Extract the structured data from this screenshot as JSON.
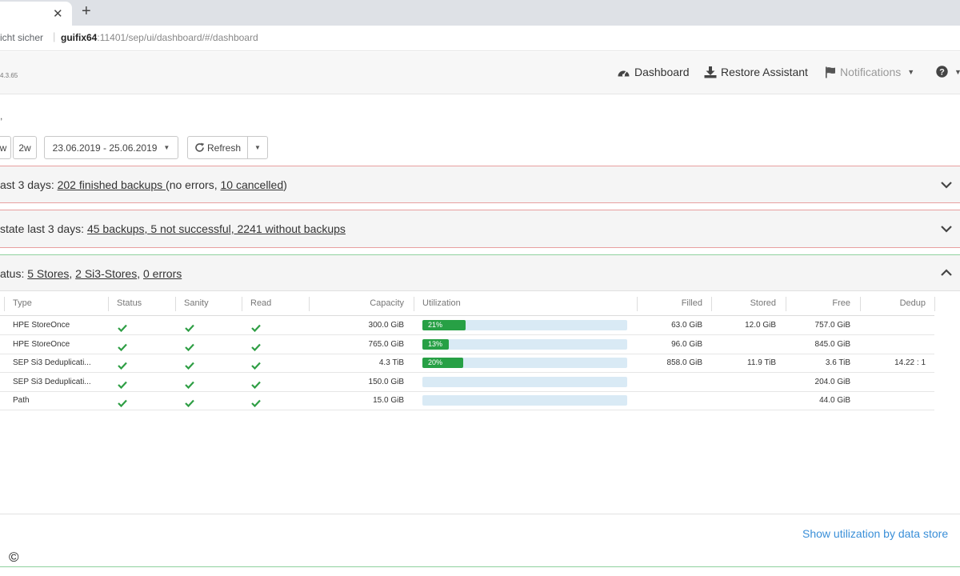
{
  "browser": {
    "security_label": "icht sicher",
    "url_host": "guifix64",
    "url_rest": ":11401/sep/ui/dashboard/#/dashboard"
  },
  "header": {
    "version": "4.3.65",
    "nav": {
      "dashboard": "Dashboard",
      "restore": "Restore Assistant",
      "notifications": "Notifications"
    }
  },
  "toolbar": {
    "stray_char": ",",
    "range_1w": "w",
    "range_2w": "2w",
    "date_range": "23.06.2019 - 25.06.2019",
    "refresh": "Refresh"
  },
  "panels": {
    "backups": {
      "prefix": "ast 3 days: ",
      "link1": "202 finished backups ",
      "mid": "(no errors, ",
      "link2": "10 cancelled",
      "suffix": ")"
    },
    "state": {
      "prefix": "state last 3 days: ",
      "link1": "45 backups, ",
      "mid": " ",
      "link2": "5 not successful, 2241 without backups",
      "suffix": ""
    },
    "stores": {
      "prefix": "atus: ",
      "link1": "5 Stores",
      "sep1": ", ",
      "link2": "2 Si3-Stores",
      "sep2": ", ",
      "link3": "0 errors"
    }
  },
  "table": {
    "columns": {
      "type": "Type",
      "status": "Status",
      "sanity": "Sanity",
      "read": "Read",
      "capacity": "Capacity",
      "utilization": "Utilization",
      "filled": "Filled",
      "stored": "Stored",
      "free": "Free",
      "dedup": "Dedup"
    },
    "rows": [
      {
        "type": "HPE StoreOnce",
        "capacity": "300.0 GiB",
        "util": 21,
        "util_label": "21%",
        "filled": "63.0 GiB",
        "stored": "12.0 GiB",
        "free": "757.0 GiB",
        "dedup": ""
      },
      {
        "type": "HPE StoreOnce",
        "capacity": "765.0 GiB",
        "util": 13,
        "util_label": "13%",
        "filled": "96.0 GiB",
        "stored": "",
        "free": "845.0 GiB",
        "dedup": ""
      },
      {
        "type": "SEP Si3 Deduplicati...",
        "capacity": "4.3 TiB",
        "util": 20,
        "util_label": "20%",
        "filled": "858.0 GiB",
        "stored": "11.9 TiB",
        "free": "3.6 TiB",
        "dedup": "14.22 : 1"
      },
      {
        "type": "SEP Si3 Deduplicati...",
        "capacity": "150.0 GiB",
        "util": 0,
        "util_label": "",
        "filled": "",
        "stored": "",
        "free": "204.0 GiB",
        "dedup": ""
      },
      {
        "type": "Path",
        "capacity": "15.0 GiB",
        "util": 0,
        "util_label": "",
        "filled": "",
        "stored": "",
        "free": "44.0 GiB",
        "dedup": ""
      }
    ]
  },
  "footer": {
    "util_link": "Show utilization by data store",
    "copyright": "©"
  },
  "colors": {
    "ok_green": "#27a045",
    "alert_red": "#e8a0a0",
    "link_blue": "#3a8fd8",
    "bar_bg": "#d9eaf5"
  }
}
